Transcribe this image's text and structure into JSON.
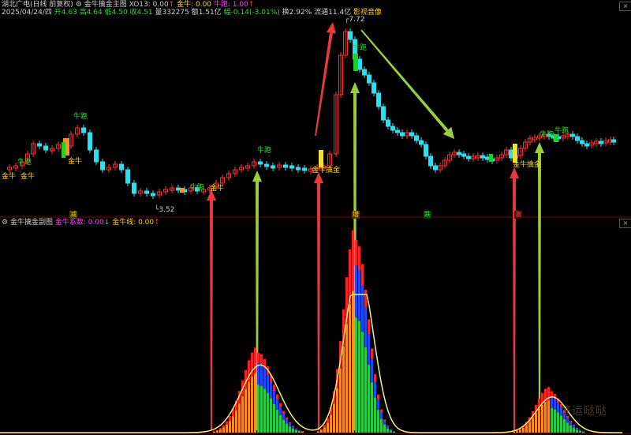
{
  "upper": {
    "title": "湖北广电(日线 前复权)",
    "indicator": "金牛擒金主图",
    "xo_label": "XO13: 0.00",
    "xo_arrow": "↑",
    "jn_label": "金牛: 0.00",
    "nb_label": "牛跑: 1.00",
    "nb_arrow": "↑",
    "date": "2025/04/24/四",
    "open": "开4.63",
    "high": "高4.64",
    "low": "低4.50",
    "close": "收4.51",
    "volume": "量332275",
    "amount": "额1.51亿",
    "change": "幅-0.14(-3.01%)",
    "turnover": "换2.92%",
    "float_cap": "流通11.4亿",
    "extra": "影视音像",
    "high_mark": "7.72",
    "low_mark": "3.52",
    "labels": {
      "jinniu": "金牛",
      "niupao": "牛跑",
      "jinniu_qinjin": "金牛擒金"
    },
    "bottom_tags": [
      "减",
      "增",
      "跌",
      "涨"
    ]
  },
  "lower": {
    "indicator": "金牛擒金副图",
    "coef_label": "金牛系数: 0.00",
    "coef_arrow": "↓",
    "line_label": "金牛线: 0.00",
    "line_arrow": "↑"
  },
  "watermark": "好运哒哒",
  "colors": {
    "up": "#ff2a2a",
    "down": "#28e0f0",
    "green_arrow": "#9bcf3a",
    "red_arrow": "#e83a3a",
    "yellow": "#f0e030"
  }
}
